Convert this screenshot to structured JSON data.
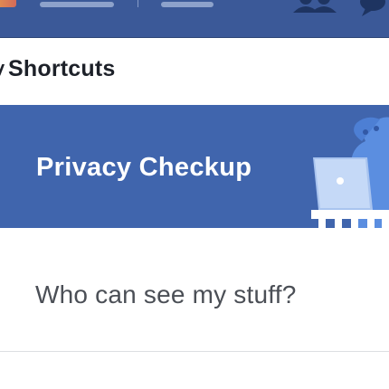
{
  "colors": {
    "nav_blue": "#3b5998",
    "banner_blue": "#4065ad",
    "text_dark": "#1d2129",
    "text_gray": "#4b4f56",
    "divider": "#dddfe2"
  },
  "navbar": {
    "icons": [
      "friends-icon",
      "messages-icon"
    ]
  },
  "shortcuts": {
    "chevron": "˅",
    "title": "Shortcuts"
  },
  "privacy_banner": {
    "title": "Privacy Checkup",
    "illustration": "privacy-dinosaur-with-laptop"
  },
  "stuff_row": {
    "label": "Who can see my stuff?"
  }
}
